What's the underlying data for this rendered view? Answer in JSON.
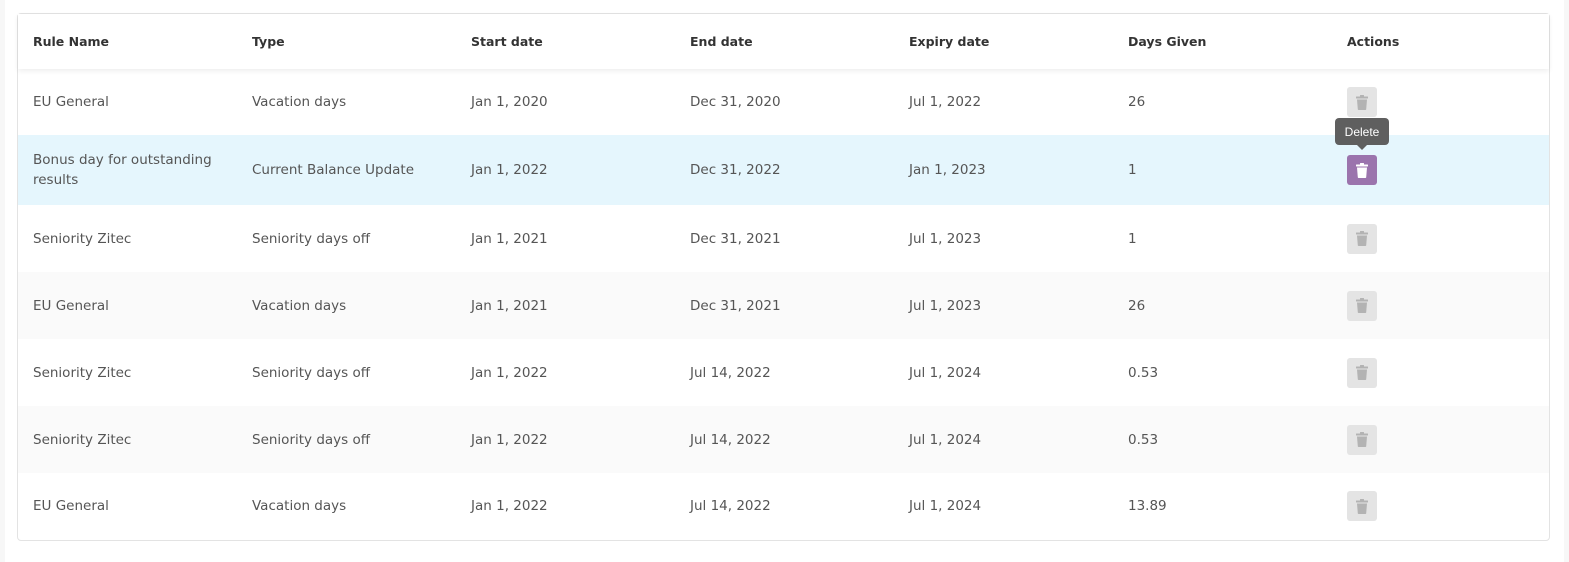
{
  "table": {
    "headers": {
      "rule_name": "Rule Name",
      "type": "Type",
      "start_date": "Start date",
      "end_date": "End date",
      "expiry_date": "Expiry date",
      "days_given": "Days Given",
      "actions": "Actions"
    },
    "rows": [
      {
        "rule_name": "EU General",
        "type": "Vacation days",
        "start_date": "Jan 1, 2020",
        "end_date": "Dec 31, 2020",
        "expiry_date": "Jul 1, 2022",
        "days_given": "26"
      },
      {
        "rule_name": "Bonus day for outstanding results",
        "type": "Current Balance Update",
        "start_date": "Jan 1, 2022",
        "end_date": "Dec 31, 2022",
        "expiry_date": "Jan 1, 2023",
        "days_given": "1"
      },
      {
        "rule_name": "Seniority Zitec",
        "type": "Seniority days off",
        "start_date": "Jan 1, 2021",
        "end_date": "Dec 31, 2021",
        "expiry_date": "Jul 1, 2023",
        "days_given": "1"
      },
      {
        "rule_name": "EU General",
        "type": "Vacation days",
        "start_date": "Jan 1, 2021",
        "end_date": "Dec 31, 2021",
        "expiry_date": "Jul 1, 2023",
        "days_given": "26"
      },
      {
        "rule_name": "Seniority Zitec",
        "type": "Seniority days off",
        "start_date": "Jan 1, 2022",
        "end_date": "Jul 14, 2022",
        "expiry_date": "Jul 1, 2024",
        "days_given": "0.53"
      },
      {
        "rule_name": "Seniority Zitec",
        "type": "Seniority days off",
        "start_date": "Jan 1, 2022",
        "end_date": "Jul 14, 2022",
        "expiry_date": "Jul 1, 2024",
        "days_given": "0.53"
      },
      {
        "rule_name": "EU General",
        "type": "Vacation days",
        "start_date": "Jan 1, 2022",
        "end_date": "Jul 14, 2022",
        "expiry_date": "Jul 1, 2024",
        "days_given": "13.89"
      }
    ],
    "action_icon": "trash-icon",
    "highlighted_row_index": 1
  },
  "tooltip": {
    "text": "Delete"
  },
  "colors": {
    "highlight_row": "#e5f6fd",
    "delete_active": "#9b74ad",
    "delete_idle": "#e4e4e4",
    "tooltip_bg": "#5f5f5f"
  }
}
